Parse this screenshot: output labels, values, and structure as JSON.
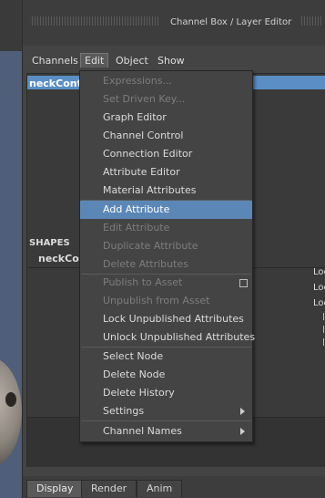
{
  "window": {
    "title": "Channel Box / Layer Editor"
  },
  "menubar": {
    "channels": "Channels",
    "edit": "Edit",
    "object": "Object",
    "show": "Show"
  },
  "channel_box": {
    "selected_node": "neckControl",
    "shapes_header": "SHAPES",
    "shape_node": "neckControlShape",
    "lock_items": [
      "Loc",
      "Loc",
      "Loc"
    ]
  },
  "edit_menu": {
    "expressions": "Expressions...",
    "set_driven_key": "Set Driven Key...",
    "graph_editor": "Graph Editor",
    "channel_control": "Channel Control",
    "connection_editor": "Connection Editor",
    "attribute_editor": "Attribute Editor",
    "material_attributes": "Material Attributes",
    "add_attribute": "Add Attribute",
    "edit_attribute": "Edit Attribute",
    "duplicate_attribute": "Duplicate Attribute",
    "delete_attributes": "Delete Attributes",
    "publish_to_asset": "Publish to Asset",
    "unpublish_from_asset": "Unpublish from Asset",
    "lock_unpublished": "Lock Unpublished Attributes",
    "unlock_unpublished": "Unlock Unpublished Attributes",
    "select_node": "Select Node",
    "delete_node": "Delete Node",
    "delete_history": "Delete History",
    "settings": "Settings",
    "channel_names": "Channel Names"
  },
  "bottom_tabs": {
    "display": "Display",
    "render": "Render",
    "anim": "Anim"
  },
  "colors": {
    "highlight": "#5b87b6",
    "selection": "#5a8ec4",
    "background": "#444444"
  }
}
